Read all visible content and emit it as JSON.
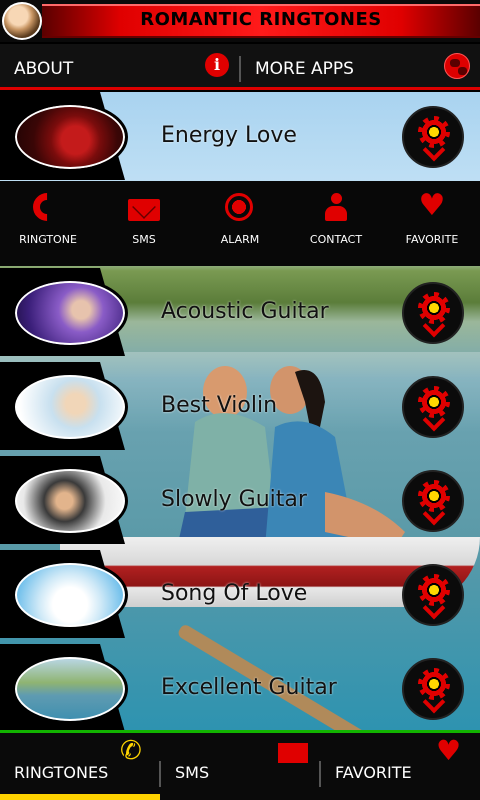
{
  "header": {
    "title": "ROMANTIC RINGTONES"
  },
  "topnav": {
    "about": "ABOUT",
    "more_apps": "MORE APPS"
  },
  "actions": [
    {
      "label": "RINGTONE",
      "icon": "phone-icon"
    },
    {
      "label": "SMS",
      "icon": "mail-icon"
    },
    {
      "label": "ALARM",
      "icon": "alarm-icon"
    },
    {
      "label": "CONTACT",
      "icon": "contact-icon"
    },
    {
      "label": "FAVORITE",
      "icon": "heart-icon"
    }
  ],
  "ringtones": [
    {
      "title": "Energy Love"
    },
    {
      "title": "Acoustic Guitar"
    },
    {
      "title": "Best Violin"
    },
    {
      "title": "Slowly Guitar"
    },
    {
      "title": "Song Of Love"
    },
    {
      "title": "Excellent Guitar"
    }
  ],
  "tabs": {
    "ringtones": "RINGTONES",
    "sms": "SMS",
    "favorite": "FAVORITE"
  },
  "colors": {
    "accent": "#e00000",
    "active_tab": "#ffd200",
    "tab_border": "#12b300"
  }
}
